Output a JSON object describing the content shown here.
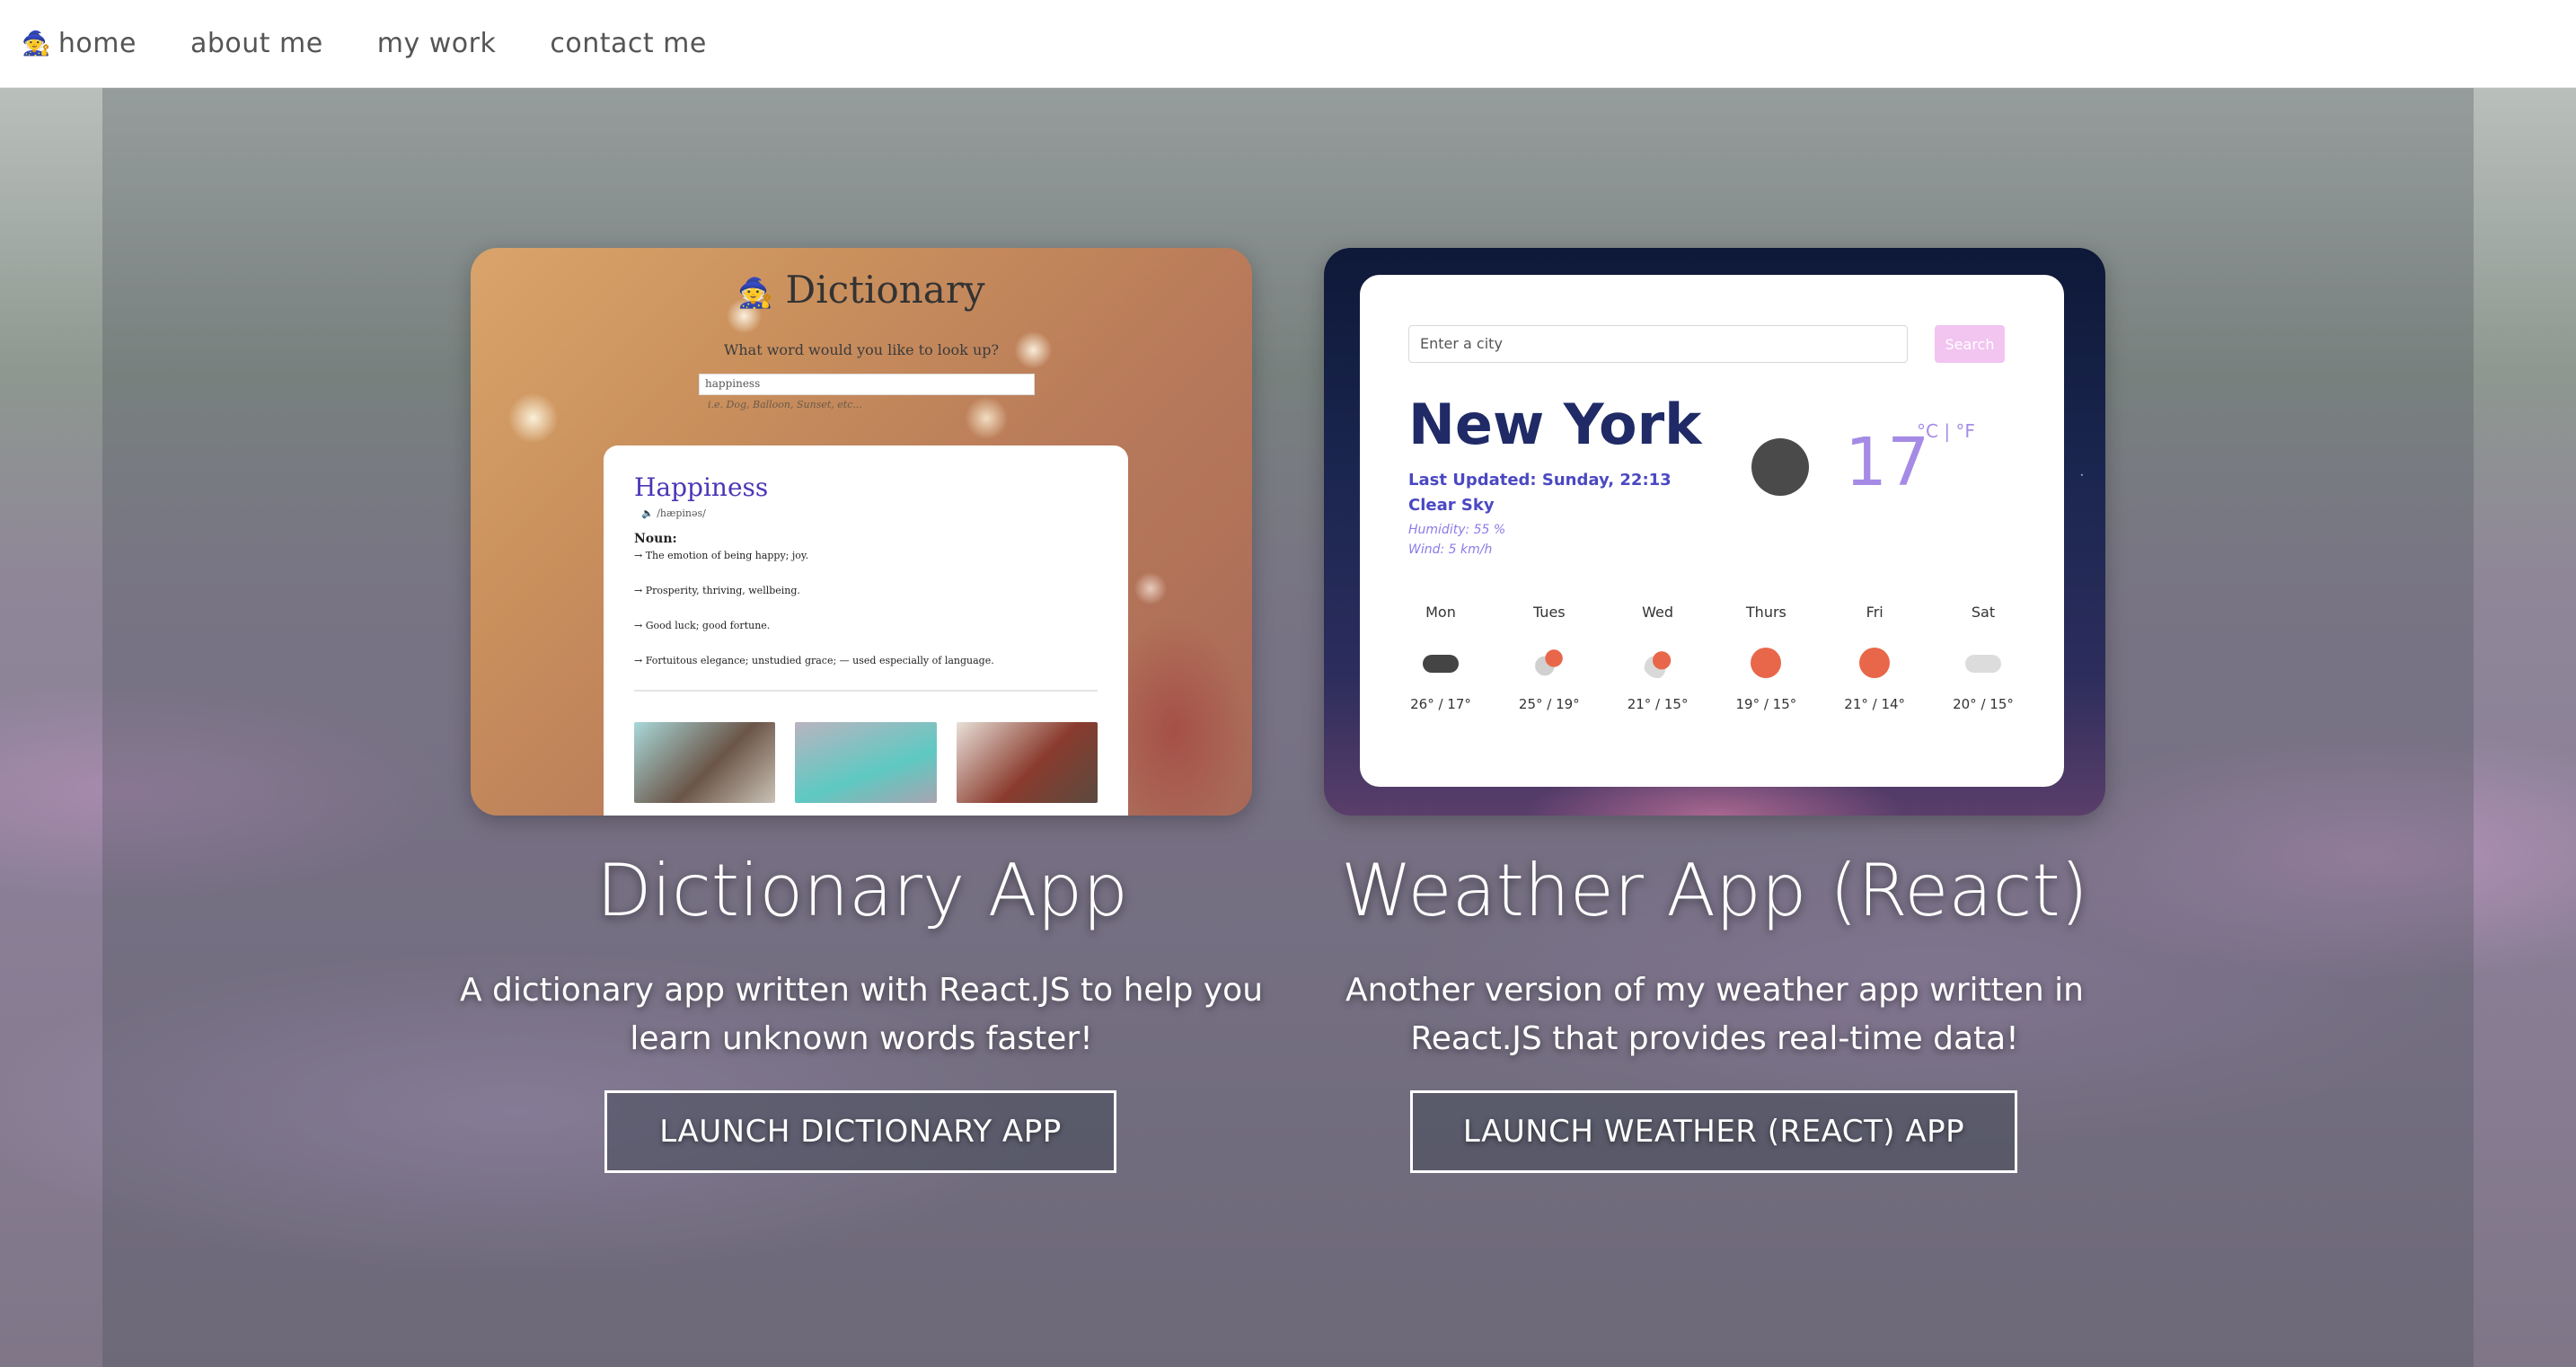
{
  "nav": {
    "home_emoji": "🧙",
    "items": [
      "home",
      "about me",
      "my work",
      "contact me"
    ]
  },
  "projects": [
    {
      "title": "Dictionary App",
      "description": "A dictionary app written with React.JS to help you learn unknown words faster!",
      "button": "LAUNCH DICTIONARY APP"
    },
    {
      "title": "Weather App (React)",
      "description": "Another version of my weather app written in React.JS that provides real-time data!",
      "button": "LAUNCH WEATHER (REACT) APP"
    }
  ],
  "dictionary_preview": {
    "emoji": "🧙",
    "title": "Dictionary",
    "question": "What word would you like to look up?",
    "input_value": "happiness",
    "hint": "i.e. Dog, Balloon, Sunset, etc...",
    "word": "Happiness",
    "phonetic": "🔈 /hæpinəs/",
    "part_of_speech": "Noun:",
    "definitions": [
      "→ The emotion of being happy; joy.",
      "→ Prosperity, thriving, wellbeing.",
      "→ Good luck; good fortune.",
      "→ Fortuitous elegance; unstudied grace; — used especially of language."
    ]
  },
  "weather_preview": {
    "placeholder": "Enter a city",
    "search": "Search",
    "city": "New York",
    "updated": "Last Updated: Sunday, 22:13",
    "condition": "Clear Sky",
    "humidity": "Humidity: 55 %",
    "wind": "Wind: 5 km/h",
    "temperature": "17",
    "units": "°C | °F",
    "forecast": [
      {
        "day": "Mon",
        "range": "26° / 17°",
        "icon": "cloud-icon",
        "color": "#444444"
      },
      {
        "day": "Tues",
        "range": "25° / 19°",
        "icon": "rain-sun-icon",
        "color": "#e8674a"
      },
      {
        "day": "Wed",
        "range": "21° / 15°",
        "icon": "cloud-sun-icon",
        "color": "#e8674a"
      },
      {
        "day": "Thurs",
        "range": "19° / 15°",
        "icon": "sun-icon",
        "color": "#e8674a"
      },
      {
        "day": "Fri",
        "range": "21° / 14°",
        "icon": "sun-icon",
        "color": "#e8674a"
      },
      {
        "day": "Sat",
        "range": "20° / 15°",
        "icon": "cloud-icon",
        "color": "#d9d9d9"
      }
    ]
  }
}
